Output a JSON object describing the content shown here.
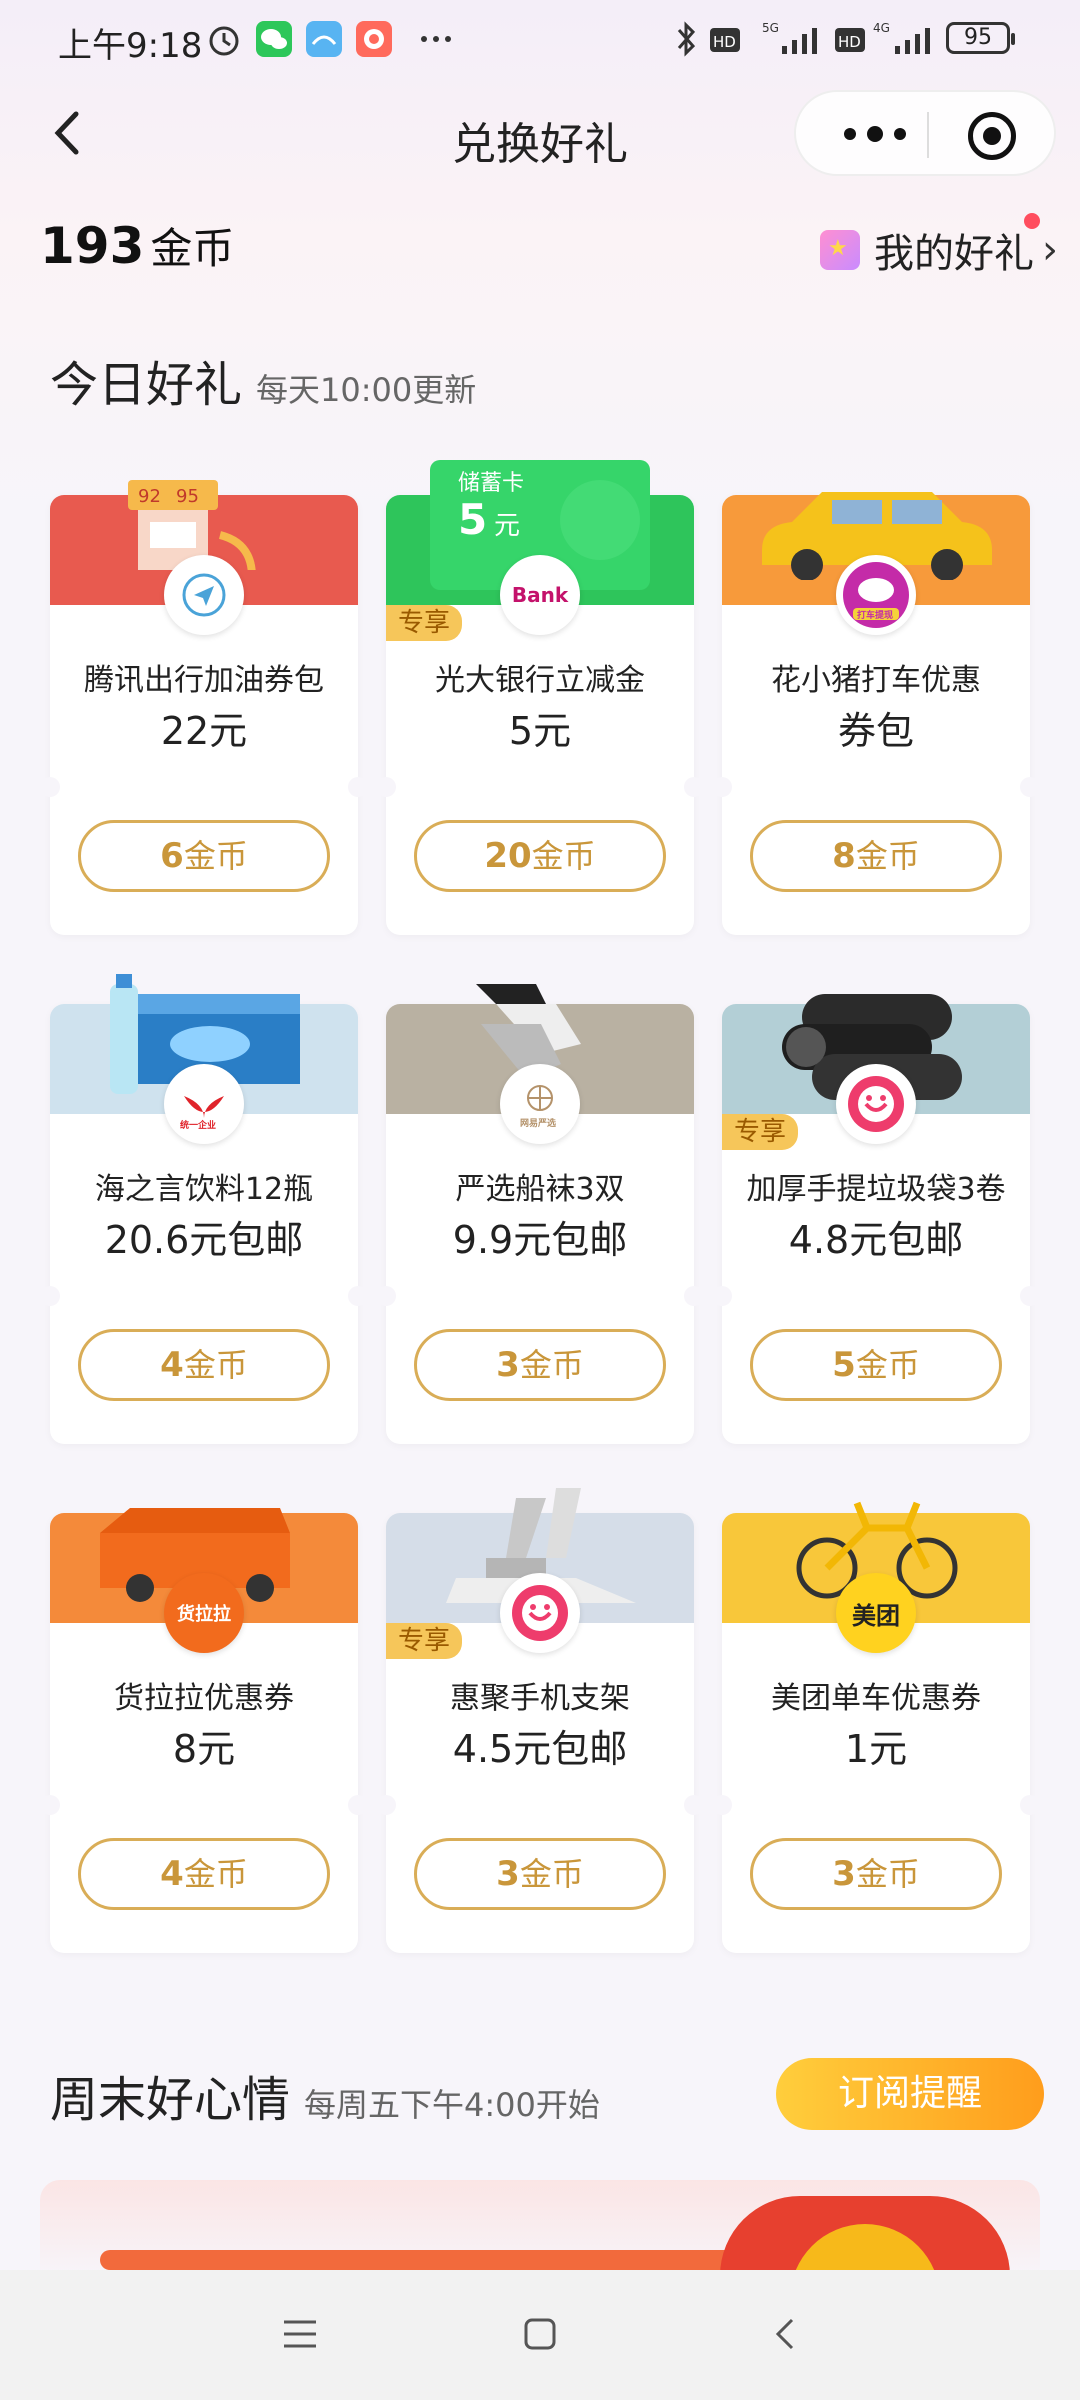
{
  "status_bar": {
    "time": "上午9:18",
    "battery": "95"
  },
  "header": {
    "title": "兑换好礼"
  },
  "coins": {
    "value": "193",
    "unit": "金币"
  },
  "my_gifts": {
    "label": "我的好礼"
  },
  "today": {
    "title": "今日好礼",
    "subtitle": "每天10:00更新"
  },
  "gifts": [
    {
      "name": "腾讯出行加油券包",
      "price": "22元",
      "coins": "6",
      "unit": "金币",
      "banner_text": [
        "92",
        "95"
      ],
      "logo": "paper-plane-icon",
      "color": "#e85a4f"
    },
    {
      "name": "光大银行立减金",
      "price": "5元",
      "coins": "20",
      "unit": "金币",
      "tag": "专享",
      "card_label": "储蓄卡",
      "card_value": "5",
      "card_unit": "元",
      "logo_text": "Bank",
      "color": "#2ec55b"
    },
    {
      "name": "花小猪打车优惠",
      "price": "券包",
      "coins": "8",
      "unit": "金币",
      "logo_label": "打车提现",
      "color": "#f79a3b"
    },
    {
      "name": "海之言饮料12瓶",
      "price": "20.6元包邮",
      "coins": "4",
      "unit": "金币",
      "logo_label": "统一企业",
      "color": "#cfe2ee"
    },
    {
      "name": "严选船袜3双",
      "price": "9.9元包邮",
      "coins": "3",
      "unit": "金币",
      "logo_label": "网易严选",
      "color": "#b9b1a2"
    },
    {
      "name": "加厚手提垃圾袋3卷",
      "price": "4.8元包邮",
      "coins": "5",
      "unit": "金币",
      "tag": "专享",
      "color": "#b3cfd6"
    },
    {
      "name": "货拉拉优惠券",
      "price": "8元",
      "coins": "4",
      "unit": "金币",
      "logo_text": "货拉拉",
      "color": "#f48a3a"
    },
    {
      "name": "惠聚手机支架",
      "price": "4.5元包邮",
      "coins": "3",
      "unit": "金币",
      "tag": "专享",
      "color": "#d5dde8"
    },
    {
      "name": "美团单车优惠券",
      "price": "1元",
      "coins": "3",
      "unit": "金币",
      "logo_text": "美团",
      "color": "#f8c73a"
    }
  ],
  "weekend": {
    "title": "周末好心情",
    "subtitle": "每周五下午4:00开始",
    "subscribe_label": "订阅提醒"
  }
}
